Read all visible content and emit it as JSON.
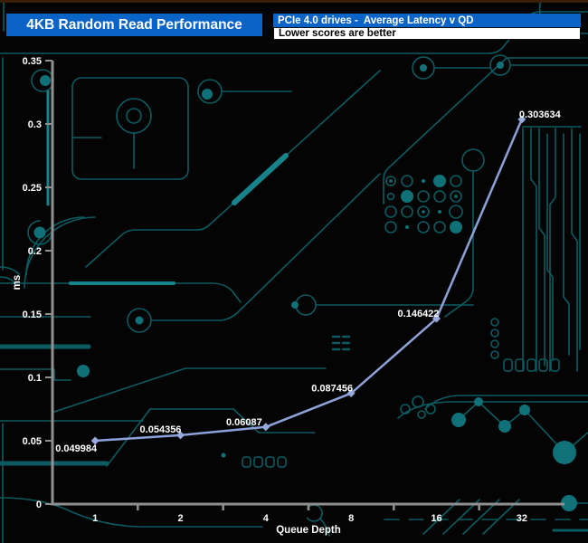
{
  "header": {
    "title": "4KB Random Read Performance",
    "subtitle": "PCIe 4.0 drives -  Average Latency v QD",
    "note": "Lower scores are better"
  },
  "colors": {
    "background": "#040404",
    "header_blue": "#0a64c8",
    "header_text": "#ffffff",
    "note_bg": "#ffffff",
    "note_text": "#000000",
    "axis": "#909090",
    "tick_text": "#ffffff",
    "series": "#8da2d9",
    "series_marker": "#96aade",
    "circuit_trace": "#0d5b62",
    "circuit_bright": "#17838a"
  },
  "chart_data": {
    "type": "line",
    "title": "4KB Random Read Performance",
    "subtitle": "PCIe 4.0 drives -  Average Latency v QD",
    "note": "Lower scores are better",
    "categories": [
      "1",
      "2",
      "4",
      "8",
      "16",
      "32"
    ],
    "values": [
      0.049984,
      0.054356,
      0.06087,
      0.087456,
      0.146422,
      0.303634
    ],
    "point_labels": [
      "0.049984",
      "0.054356",
      "0.06087",
      "0.087456",
      "0.146422",
      "0.303634"
    ],
    "label_offsets": [
      [
        -21,
        12
      ],
      [
        -22,
        -3
      ],
      [
        -24,
        -2
      ],
      [
        -21,
        -2
      ],
      [
        -20,
        -2
      ],
      [
        20,
        -2
      ]
    ],
    "xlabel": "Queue Depth",
    "ylabel": "ms",
    "ylim": [
      0,
      0.35
    ],
    "ytick_step": 0.05,
    "ytick_labels": [
      "0",
      "0.05",
      "0.1",
      "0.15",
      "0.2",
      "0.25",
      "0.3",
      "0.35"
    ],
    "grid": false,
    "legend": "none",
    "x_scale": "categorical"
  }
}
